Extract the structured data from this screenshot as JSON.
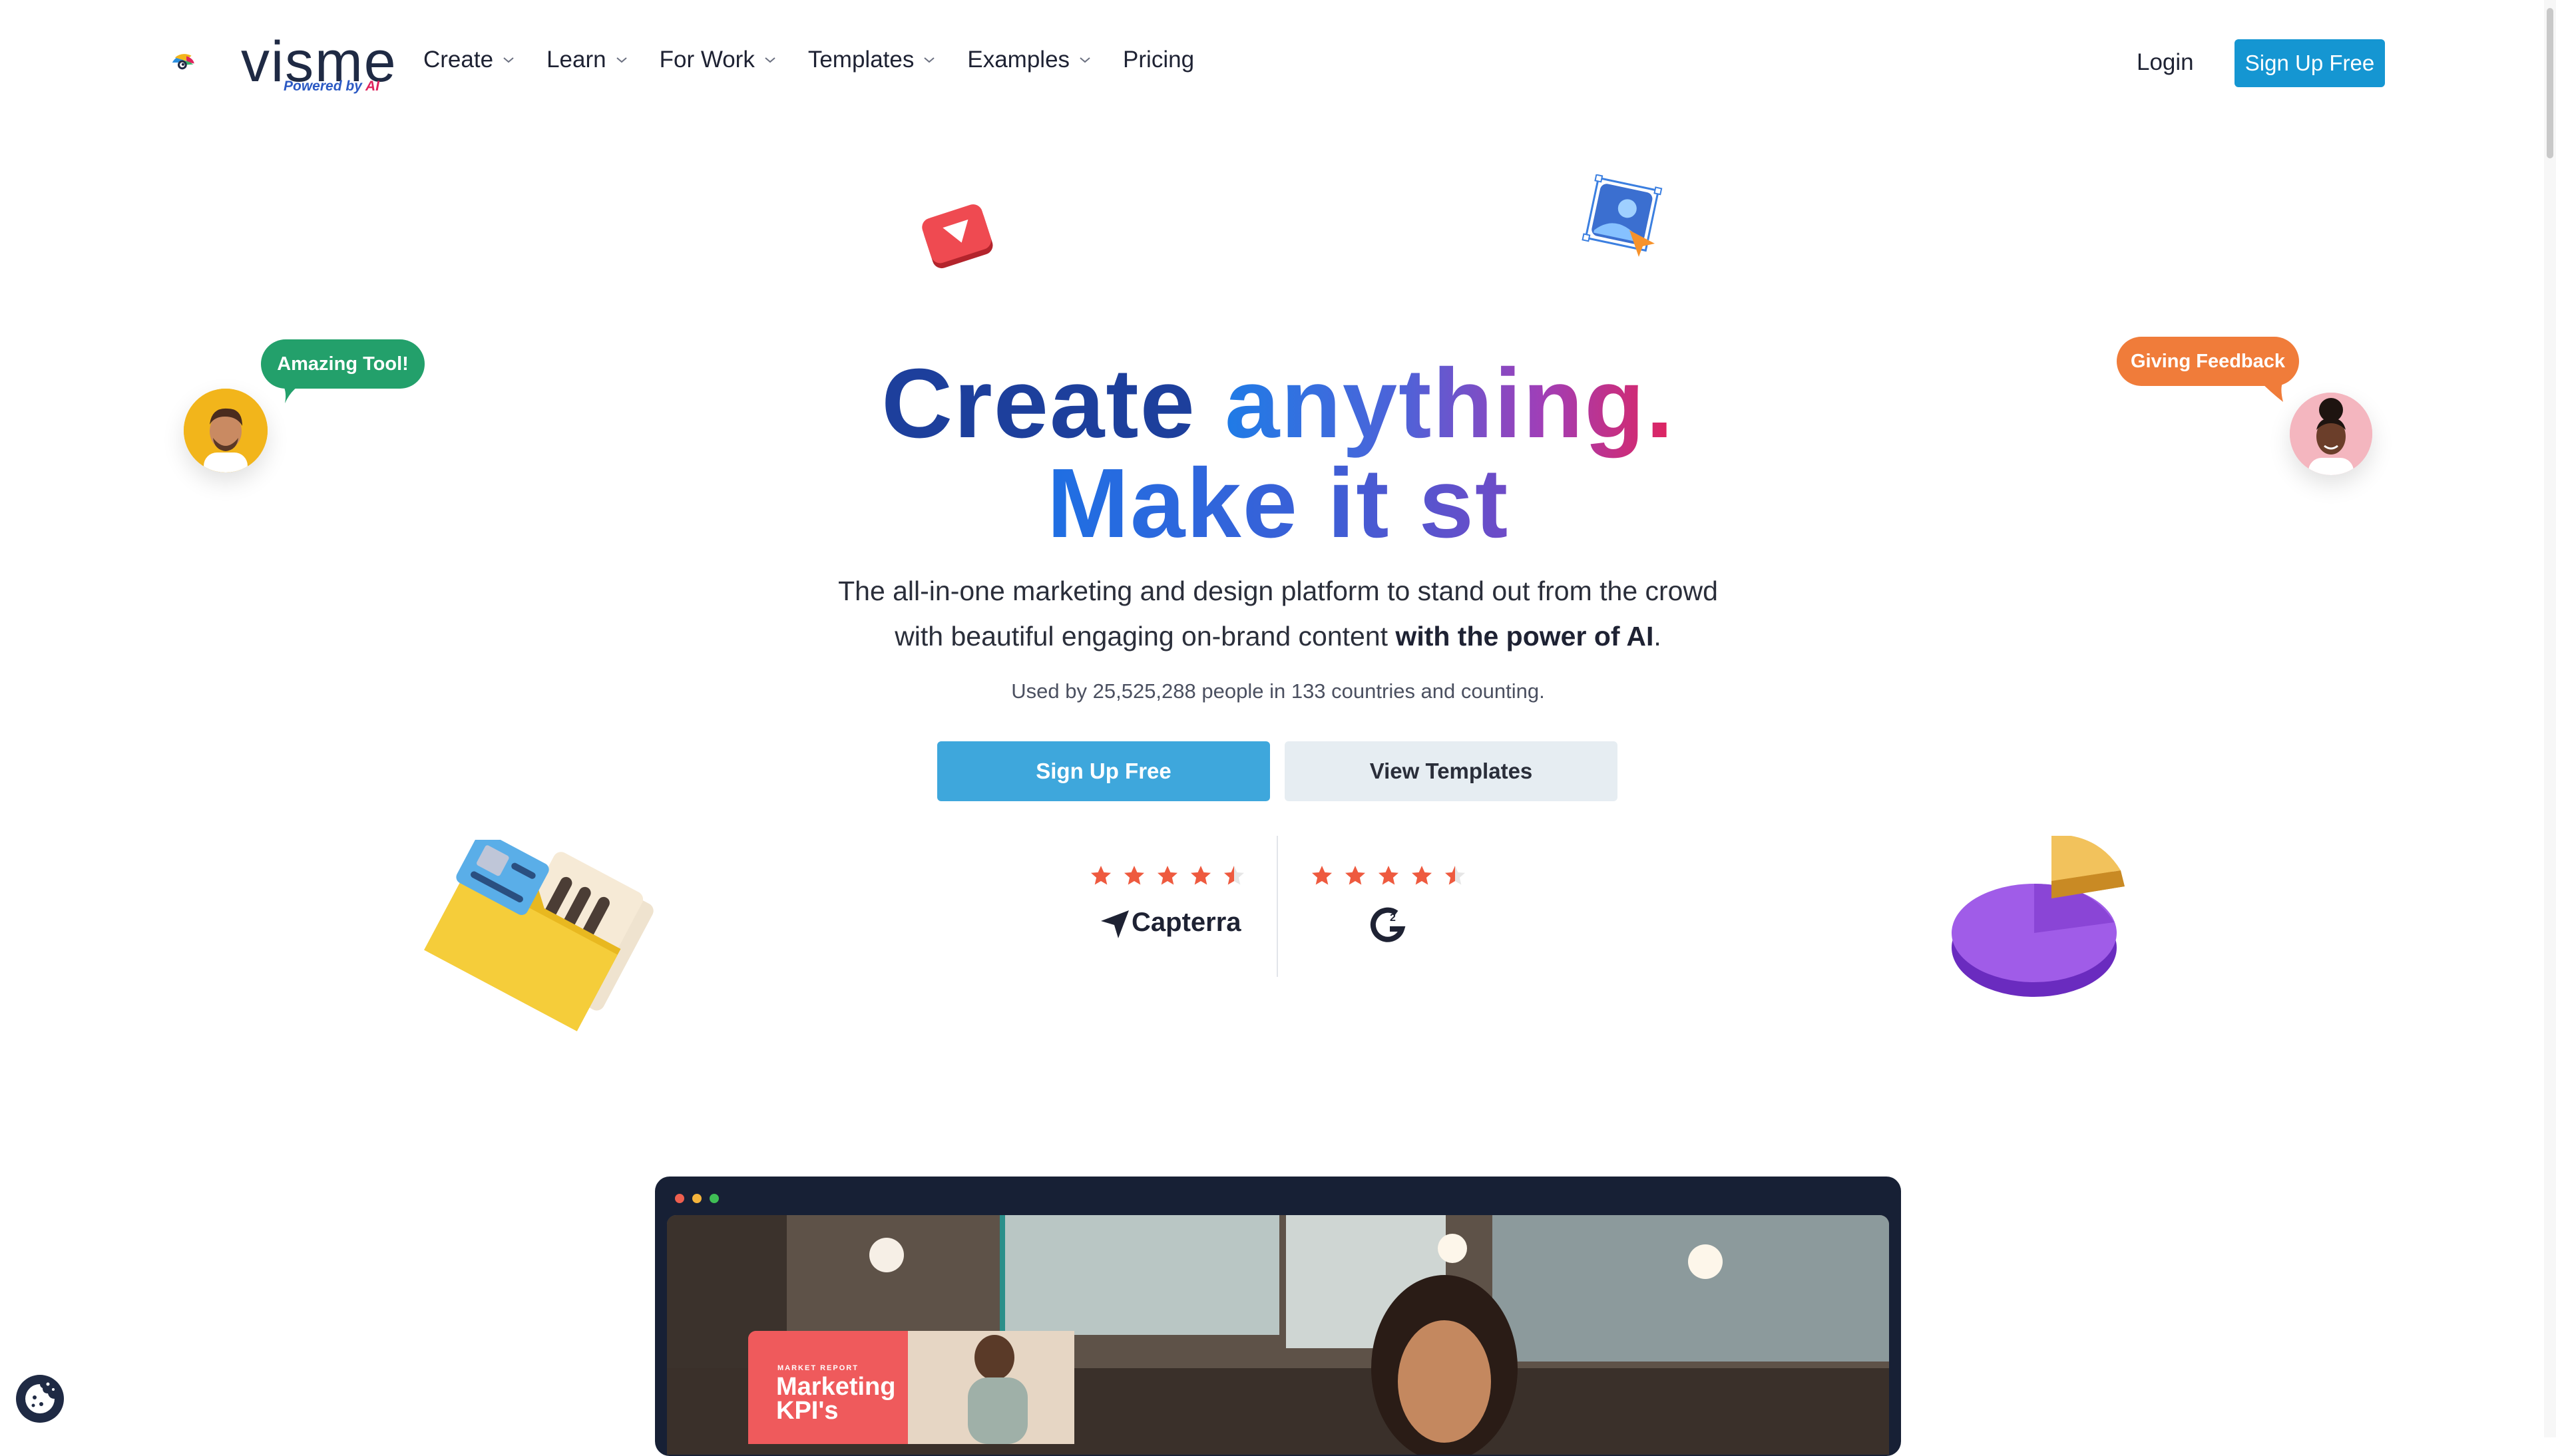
{
  "brand": {
    "name": "visme",
    "tagline_part1": "Powered by ",
    "tagline_part2": "AI"
  },
  "nav": {
    "items": [
      {
        "label": "Create",
        "has_dropdown": true
      },
      {
        "label": "Learn",
        "has_dropdown": true
      },
      {
        "label": "For Work",
        "has_dropdown": true
      },
      {
        "label": "Templates",
        "has_dropdown": true
      },
      {
        "label": "Examples",
        "has_dropdown": true
      },
      {
        "label": "Pricing",
        "has_dropdown": false
      }
    ],
    "login": "Login",
    "signup": "Sign Up Free"
  },
  "hero": {
    "title_line1_word1": "Create",
    "title_line1_word2": "anything.",
    "title_line2": "Make it st",
    "subtitle_line1": "The all-in-one marketing and design platform to stand out from the crowd",
    "subtitle_line2_pre": "with beautiful engaging on-brand content ",
    "subtitle_line2_bold": "with the power of AI",
    "subtitle_line2_post": ".",
    "used_by": "Used by 25,525,288 people in 133 countries and counting.",
    "cta_primary": "Sign Up Free",
    "cta_secondary": "View Templates"
  },
  "bubbles": {
    "left": "Amazing Tool!",
    "right": "Giving Feedback"
  },
  "ratings": [
    {
      "source": "Capterra",
      "stars": 4.5
    },
    {
      "source": "G2",
      "stars": 4.5
    }
  ],
  "preview": {
    "card_kicker": "MARKET REPORT",
    "card_title_line1": "Marketing",
    "card_title_line2": "KPI's"
  },
  "colors": {
    "brand_blue": "#1596d2",
    "cta_primary": "#3ea7dc",
    "cta_secondary": "#e6edf2",
    "star": "#ee5a3f",
    "bubble_green": "#23a06b",
    "bubble_orange": "#f07c3a"
  }
}
